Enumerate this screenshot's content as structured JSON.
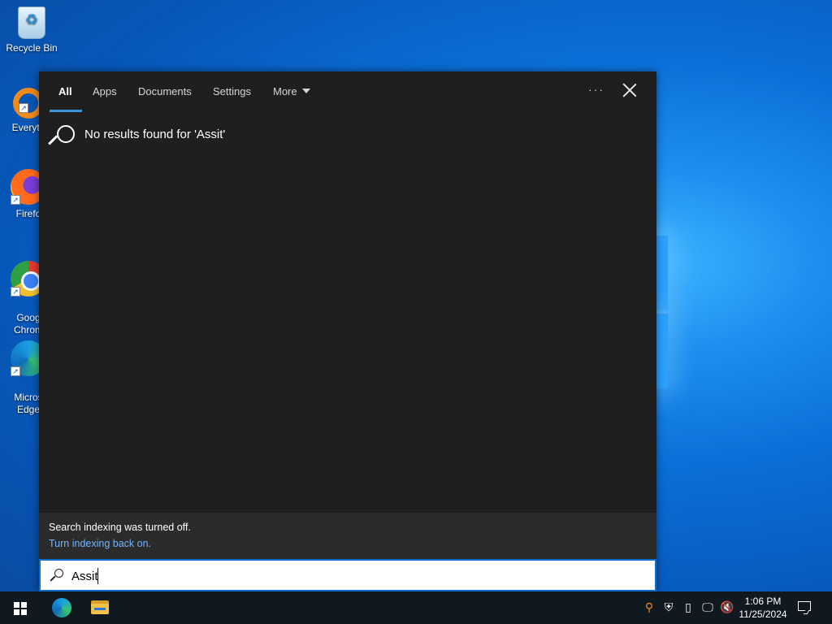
{
  "desktop": {
    "icons": [
      {
        "label": "Recycle Bin",
        "icon": "recycle-bin-icon"
      },
      {
        "label": "Everyth",
        "icon": "everything-search-icon"
      },
      {
        "label": "Firefo",
        "icon": "firefox-icon"
      },
      {
        "label": "Goog\nChrom",
        "icon": "chrome-icon"
      },
      {
        "label": "Micros\nEdge",
        "icon": "edge-icon"
      }
    ]
  },
  "search_panel": {
    "tabs": [
      {
        "label": "All",
        "active": true
      },
      {
        "label": "Apps"
      },
      {
        "label": "Documents"
      },
      {
        "label": "Settings"
      },
      {
        "label": "More"
      }
    ],
    "overflow_label": "···",
    "no_results": "No results found for 'Assit'",
    "notice": {
      "message": "Search indexing was turned off.",
      "link": "Turn indexing back on."
    },
    "search_box": {
      "value": "Assit",
      "placeholder": ""
    }
  },
  "taskbar": {
    "start_icon": "windows-logo-icon",
    "pinned": [
      {
        "name": "Microsoft Edge",
        "icon": "edge-icon"
      },
      {
        "name": "File Explorer",
        "icon": "folder-icon"
      }
    ],
    "tray": {
      "icons": [
        "everything-search-icon",
        "shield-icon",
        "usb-icon",
        "network-icon",
        "volume-muted-icon"
      ],
      "time": "1:06 PM",
      "date": "11/25/2024"
    }
  },
  "colors": {
    "accent": "#0c6fcf",
    "link": "#6fb6ff",
    "panel_bg": "#1f1f1f",
    "taskbar_bg": "#101820"
  }
}
